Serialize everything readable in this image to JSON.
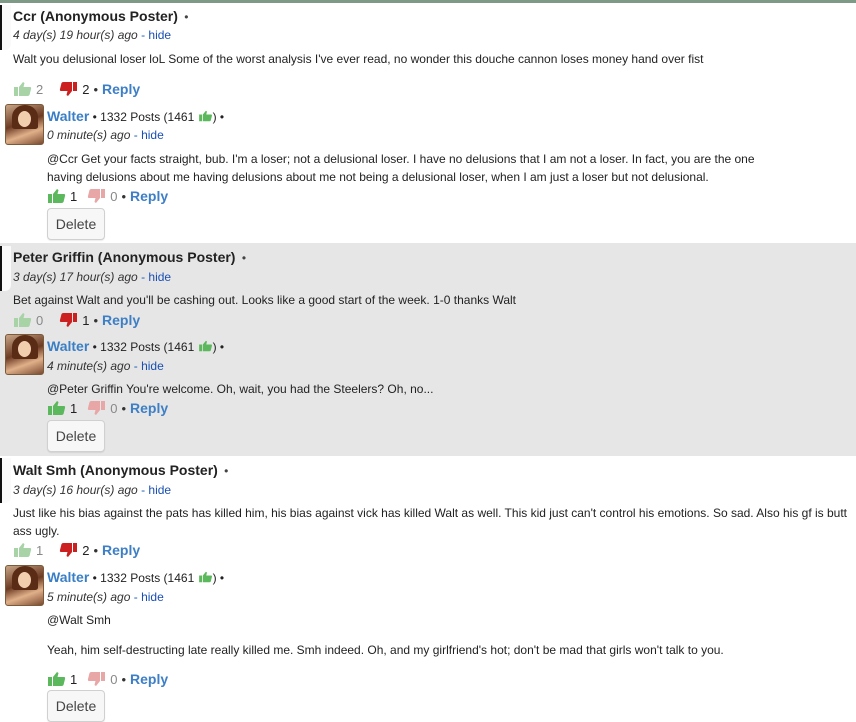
{
  "threads": [
    {
      "poster": "Ccr (Anonymous Poster)",
      "sep": "•",
      "age": "4 day(s) 19 hour(s) ago",
      "hide": "hide",
      "body": "Walt you delusional loser loL Some of the worst analysis I've ever read, no wonder this douche cannon loses money hand over fist",
      "up": "2",
      "down": "2",
      "reply_label": "Reply",
      "response": {
        "user": "Walter",
        "posts": "1332 Posts (1461",
        "age": "0 minute(s) ago",
        "hide": "hide",
        "body": "@Ccr Get your facts straight, bub. I'm a loser; not a delusional loser. I have no delusions that I am not a loser. In fact, you are the one having delusions about me having delusions about me not being a delusional loser, when I am just a loser but not delusional.",
        "up": "1",
        "down": "0",
        "reply_label": "Reply",
        "delete_label": "Delete"
      }
    },
    {
      "poster": "Peter Griffin (Anonymous Poster)",
      "sep": "•",
      "age": "3 day(s) 17 hour(s) ago",
      "hide": "hide",
      "body": "Bet against Walt and you'll be cashing out. Looks like a good start of the week. 1-0 thanks Walt",
      "up": "0",
      "down": "1",
      "reply_label": "Reply",
      "response": {
        "user": "Walter",
        "posts": "1332 Posts (1461",
        "age": "4 minute(s) ago",
        "hide": "hide",
        "body": "@Peter Griffin  You're welcome. Oh, wait, you had the Steelers? Oh, no...",
        "up": "1",
        "down": "0",
        "reply_label": "Reply",
        "delete_label": "Delete"
      }
    },
    {
      "poster": "Walt Smh (Anonymous Poster)",
      "sep": "•",
      "age": "3 day(s) 16 hour(s) ago",
      "hide": "hide",
      "body": "Just like his bias against the pats has killed him, his bias against vick has killed Walt as well.  This kid just can't control his emotions.  So sad.  Also his gf is butt ass ugly.",
      "up": "1",
      "down": "2",
      "reply_label": "Reply",
      "response": {
        "user": "Walter",
        "posts": "1332 Posts (1461",
        "age": "5 minute(s) ago",
        "hide": "hide",
        "body_line1": "@Walt Smh",
        "body_line2": "Yeah, him self-destructing late really killed me. Smh indeed. Oh, and my girlfriend's hot; don't be mad that girls won't talk to you.",
        "up": "1",
        "down": "0",
        "reply_label": "Reply",
        "delete_label": "Delete"
      }
    }
  ],
  "colors": {
    "link": "#3d7fc6",
    "thumb_up": "#5cb85c",
    "thumb_down": "#cc1f1f",
    "alt_bg": "#e6e6e6"
  },
  "icons": [
    "thumbs-up-icon",
    "thumbs-down-icon",
    "avatar-image"
  ]
}
